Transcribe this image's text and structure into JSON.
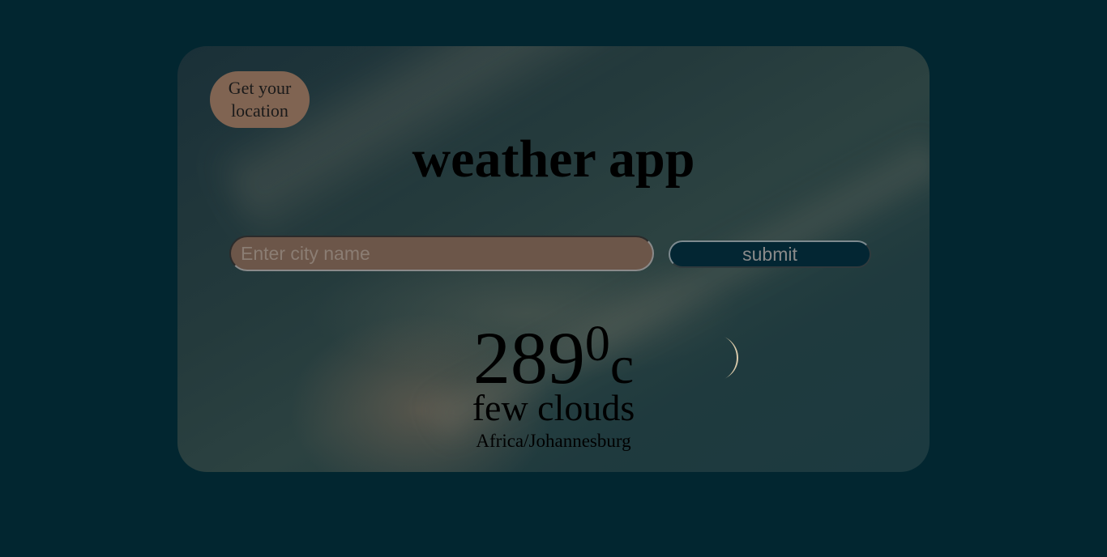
{
  "location_button": {
    "label": "Get your location"
  },
  "header": {
    "title": "weather app"
  },
  "search": {
    "placeholder": "Enter city name",
    "value": ""
  },
  "submit": {
    "label": "submit"
  },
  "weather": {
    "temperature": "289",
    "degree_symbol": "0",
    "unit": "c",
    "description": "few clouds",
    "timezone": "Africa/Johannesburg"
  },
  "background_image": {
    "icon": "moon-icon"
  },
  "colors": {
    "page_bg": "#022630",
    "location_button_bg": "#806452",
    "input_bg": "#6c5649",
    "submit_bg": "#032633"
  }
}
